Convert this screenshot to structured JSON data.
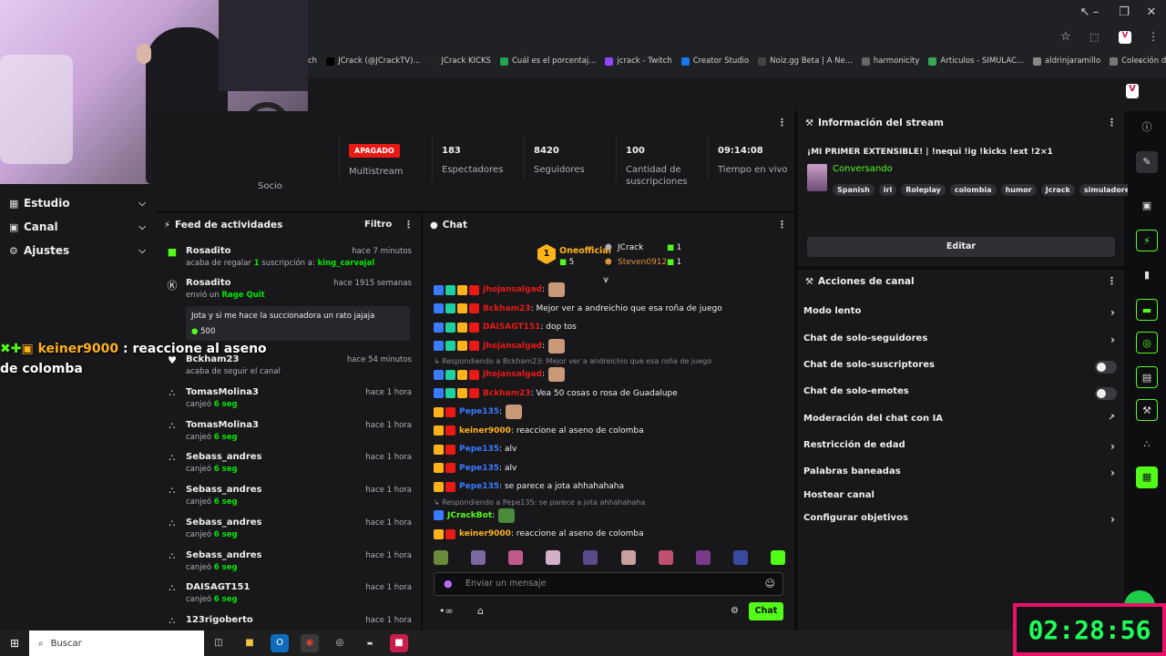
{
  "bookmarks": [
    "ch",
    "JCrack (@JCrackTV)...",
    "JCrack KICKS",
    "Cuál es el porcentaj...",
    "jcrack - Twitch",
    "Creator Studio",
    "Noiz.gg Beta | A Ne...",
    "harmonicity",
    "Articulos - SIMULAC...",
    "aldrinjaramillo",
    "Colección de M_blei..."
  ],
  "overlay_chat": {
    "username": "keiner9000",
    "message": ": reaccione al aseno de colomba"
  },
  "nav": {
    "studio": "Estudio",
    "channel": "Canal",
    "settings": "Ajustes"
  },
  "stats": {
    "partner_label": "Socio",
    "multistream_badge": "APAGADO",
    "multistream_label": "Multistream",
    "items": [
      {
        "value": "183",
        "label": "Espectadores"
      },
      {
        "value": "8420",
        "label": "Seguidores"
      },
      {
        "value": "100",
        "label": "Cantidad de suscripciones"
      },
      {
        "value": "09:14:08",
        "label": "Tiempo en vivo"
      }
    ]
  },
  "feed": {
    "title": "Feed de actividades",
    "filter": "Filtro",
    "items": [
      {
        "name": "Rosadito",
        "time": "hace 7 minutos",
        "pre": "acaba de regalar ",
        "num": "1",
        "mid": " suscripción a: ",
        "hl": "king_carvajal"
      },
      {
        "name": "Rosadito",
        "time": "hace 1915 semanas",
        "pre": "envió un ",
        "hl": "Rage Quit",
        "message": "Jota y si me hace la succionadora un rato jajaja",
        "amount": "500"
      },
      {
        "name": "Bckham23",
        "time": "hace 54 minutos",
        "pre": "acaba de seguir el canal"
      },
      {
        "name": "TomasMolina3",
        "time": "hace 1 hora",
        "pre": "canjeó ",
        "hl": "6 seg"
      },
      {
        "name": "TomasMolina3",
        "time": "hace 1 hora",
        "pre": "canjeó ",
        "hl": "6 seg"
      },
      {
        "name": "Sebass_andres",
        "time": "hace 1 hora",
        "pre": "canjeó ",
        "hl": "6 seg"
      },
      {
        "name": "Sebass_andres",
        "time": "hace 1 hora",
        "pre": "canjeó ",
        "hl": "6 seg"
      },
      {
        "name": "Sebass_andres",
        "time": "hace 1 hora",
        "pre": "canjeó ",
        "hl": "6 seg"
      },
      {
        "name": "Sebass_andres",
        "time": "hace 1 hora",
        "pre": "canjeó ",
        "hl": "6 seg"
      },
      {
        "name": "DAISAGT151",
        "time": "hace 1 hora",
        "pre": "canjeó ",
        "hl": "6 seg"
      },
      {
        "name": "123rigoberto",
        "time": "hace 1 hora"
      }
    ]
  },
  "chat": {
    "title": "Chat",
    "leaderboard": {
      "top_name": "Oneofficial",
      "top_count": "5",
      "second_name": "JCrack",
      "second_count": "1",
      "third_name": "Steven0912",
      "third_count": "1"
    },
    "lines": [
      {
        "user": "Jhojansalgad",
        "color": "#e91916",
        "text": ":",
        "emote": true
      },
      {
        "user": "Bckham23",
        "color": "#e91916",
        "text": ": Mejor ver a andreichio que esa roña de juego"
      },
      {
        "user": "DAISAGT151",
        "color": "#e91916",
        "text": ": dop tos"
      },
      {
        "user": "Jhojansalgad",
        "color": "#e91916",
        "text": ":",
        "emote": true
      },
      {
        "reply": "Respondiendo a Bckham23: Mejor ver a andreichio que esa roña de juego"
      },
      {
        "user": "Jhojansalgad",
        "color": "#e91916",
        "text": ":",
        "emote": true
      },
      {
        "user": "Bckham23",
        "color": "#e91916",
        "text": ": Vea 50 cosas o rosa de Guadalupe"
      },
      {
        "user": "Pepe135",
        "color": "#3a7bff",
        "text": ":",
        "emote": true
      },
      {
        "user": "keiner9000",
        "color": "#ffb31a",
        "text": ": reaccione al aseno de colomba"
      },
      {
        "user": "Pepe135",
        "color": "#3a7bff",
        "text": ": alv"
      },
      {
        "user": "Pepe135",
        "color": "#3a7bff",
        "text": ": alv"
      },
      {
        "user": "Pepe135",
        "color": "#3a7bff",
        "text": ": se parece a jota ahhahahaha"
      },
      {
        "reply": "Respondiendo a Pepe135: se parece a jota ahhahahaha"
      },
      {
        "user": "JCrackBot",
        "color": "#53fc18",
        "text": ":",
        "emote": true
      },
      {
        "user": "keiner9000",
        "color": "#ffb31a",
        "text": ": reaccione al aseno de colomba"
      }
    ],
    "input_placeholder": "Enviar un mensaje",
    "send_label": "Chat"
  },
  "stream_info": {
    "title": "Información del stream",
    "stream_title": "¡MI PRIMER EXTENSIBLE! | !nequi !ig !kicks !ext !2×1",
    "category": "Conversando",
    "tags": [
      "Spanish",
      "irl",
      "Roleplay",
      "colombia",
      "humor",
      "Jcrack",
      "simuladores"
    ],
    "edit_label": "Editar"
  },
  "actions": {
    "title": "Acciones de canal",
    "items": [
      {
        "label": "Modo lento",
        "kind": "arrow"
      },
      {
        "label": "Chat de solo-seguidores",
        "kind": "arrow"
      },
      {
        "label": "Chat de solo-suscriptores",
        "kind": "toggle"
      },
      {
        "label": "Chat de solo-emotes",
        "kind": "toggle"
      },
      {
        "label": "Moderación del chat con IA",
        "kind": "external"
      },
      {
        "label": "Restricción de edad",
        "kind": "arrow"
      },
      {
        "label": "Palabras baneadas",
        "kind": "arrow"
      },
      {
        "label": "Hostear canal",
        "kind": "none"
      },
      {
        "label": "Configurar objetivos",
        "kind": "arrow"
      }
    ]
  },
  "taskbar": {
    "search": "Buscar"
  },
  "timer": "02:28:56",
  "colors": {
    "accent": "#53fc18",
    "panel": "#18181b",
    "bg": "#0c0c0e",
    "danger": "#e91916"
  }
}
